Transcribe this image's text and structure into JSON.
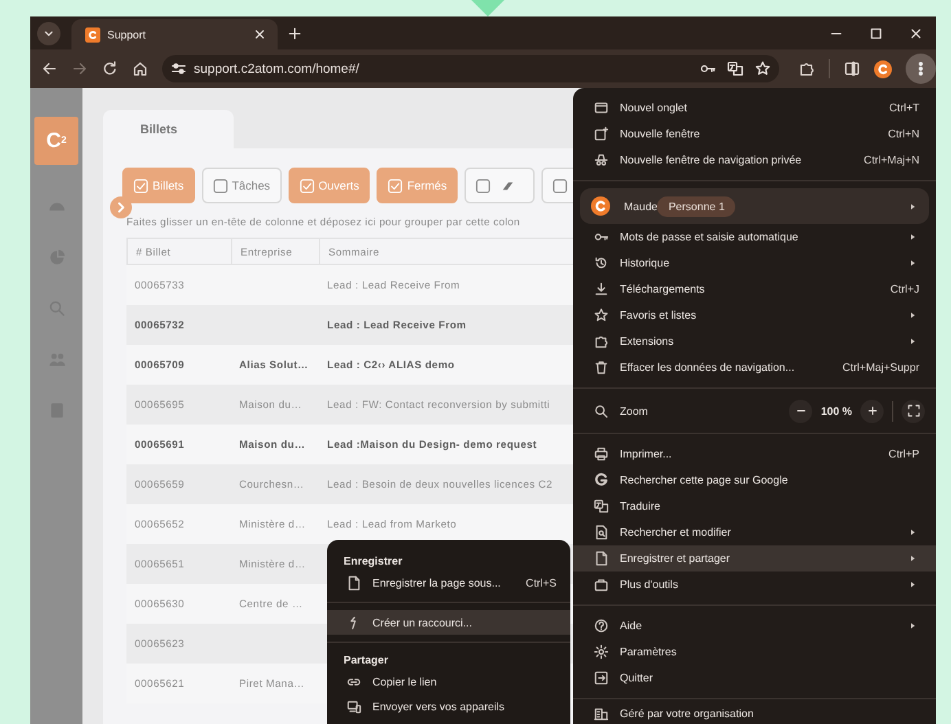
{
  "tabs": [
    {
      "title": "Support",
      "selected": true
    }
  ],
  "toolbar": {
    "url": "support.c2atom.com/home#/"
  },
  "app": {
    "logo": "C$^{2}$",
    "page_tabs": [
      {
        "label": "Billets",
        "selected": true
      }
    ],
    "filters": [
      {
        "kind": "text",
        "label": "Billets",
        "checked": true
      },
      {
        "kind": "text",
        "label": "Tâches",
        "checked": false
      },
      {
        "kind": "text",
        "label": "Ouverts",
        "checked": true
      },
      {
        "kind": "text",
        "label": "Fermés",
        "checked": true
      },
      {
        "kind": "icon",
        "checked": false
      },
      {
        "kind": "icon",
        "checked": false
      }
    ],
    "group_hint": "Faites glisser un en-tête de colonne et déposez ici pour grouper par cette colon",
    "table": {
      "columns": [
        "# Billet",
        "Entreprise",
        "Sommaire"
      ],
      "rows": [
        {
          "cells": [
            "00065733",
            "",
            "Lead : Lead Receive From"
          ],
          "unread": false
        },
        {
          "cells": [
            "00065732",
            "",
            "Lead : Lead Receive From"
          ],
          "unread": true
        },
        {
          "cells": [
            "00065709",
            "Alias Solut…",
            "Lead : C2‹› ALIAS demo"
          ],
          "unread": true
        },
        {
          "cells": [
            "00065695",
            "Maison du…",
            "Lead : FW: Contact reconversion by submitti"
          ],
          "unread": false
        },
        {
          "cells": [
            "00065691",
            "Maison du…",
            "Lead :Maison du Design- demo request"
          ],
          "unread": true
        },
        {
          "cells": [
            "00065659",
            "Courchesn…",
            "Lead : Besoin de deux nouvelles licences C2"
          ],
          "unread": false
        },
        {
          "cells": [
            "00065652",
            "Ministère d…",
            "Lead : Lead from Marketo"
          ],
          "unread": false
        },
        {
          "cells": [
            "00065651",
            "Ministère d…",
            ""
          ],
          "unread": false
        },
        {
          "cells": [
            "00065630",
            "Centre de …",
            ""
          ],
          "unread": false
        },
        {
          "cells": [
            "00065623",
            "",
            ""
          ],
          "unread": false
        },
        {
          "cells": [
            "00065621",
            "Piret Mana…",
            ""
          ],
          "unread": false
        }
      ]
    }
  },
  "menu": {
    "sections": [
      {
        "items": [
          {
            "kind": "item",
            "label": "Nouvel onglet",
            "shortcut": "Ctrl+T",
            "submenu": false,
            "highlighted": false
          },
          {
            "kind": "item",
            "label": "Nouvelle fenêtre",
            "shortcut": "Ctrl+N",
            "submenu": false,
            "highlighted": false
          },
          {
            "kind": "item",
            "label": "Nouvelle fenêtre de navigation privée",
            "shortcut": "Ctrl+Maj+N",
            "submenu": false,
            "highlighted": false
          }
        ]
      },
      {
        "items": [
          {
            "kind": "profile",
            "label": "Maude",
            "badge": "Personne 1",
            "submenu": true,
            "highlighted": false
          },
          {
            "kind": "item",
            "label": "Mots de passe et saisie automatique",
            "submenu": true,
            "highlighted": false
          },
          {
            "kind": "item",
            "label": "Historique",
            "submenu": true,
            "highlighted": false
          },
          {
            "kind": "item",
            "label": "Téléchargements",
            "shortcut": "Ctrl+J",
            "submenu": false,
            "highlighted": false
          },
          {
            "kind": "item",
            "label": "Favoris et listes",
            "submenu": true,
            "highlighted": false
          },
          {
            "kind": "item",
            "label": "Extensions",
            "submenu": true,
            "highlighted": false
          },
          {
            "kind": "item",
            "label": "Effacer les données de navigation...",
            "shortcut": "Ctrl+Maj+Suppr",
            "submenu": false,
            "highlighted": false
          }
        ]
      },
      {
        "items": [
          {
            "kind": "zoom",
            "label": "Zoom",
            "value": "100 %",
            "submenu": false,
            "highlighted": false
          }
        ]
      },
      {
        "items": [
          {
            "kind": "item",
            "label": "Imprimer...",
            "shortcut": "Ctrl+P",
            "submenu": false,
            "highlighted": false
          },
          {
            "kind": "item",
            "label": "Rechercher cette page sur Google",
            "submenu": false,
            "highlighted": false
          },
          {
            "kind": "item",
            "label": "Traduire",
            "submenu": false,
            "highlighted": false
          },
          {
            "kind": "item",
            "label": "Rechercher et modifier",
            "submenu": true,
            "highlighted": false
          },
          {
            "kind": "item",
            "label": "Enregistrer et partager",
            "submenu": true,
            "highlighted": true
          },
          {
            "kind": "item",
            "label": "Plus d'outils",
            "submenu": true,
            "highlighted": false
          }
        ]
      },
      {
        "items": [
          {
            "kind": "item",
            "label": "Aide",
            "submenu": true,
            "highlighted": false
          },
          {
            "kind": "item",
            "label": "Paramètres",
            "submenu": false,
            "highlighted": false
          },
          {
            "kind": "item",
            "label": "Quitter",
            "submenu": false,
            "highlighted": false
          }
        ]
      },
      {
        "items": [
          {
            "kind": "footer",
            "label": "Géré par votre organisation",
            "submenu": false,
            "highlighted": false
          }
        ]
      }
    ]
  },
  "submenu": {
    "groups": [
      {
        "heading": "Enregistrer",
        "items": [
          {
            "label": "Enregistrer la page sous...",
            "shortcut": "Ctrl+S",
            "highlighted": false
          }
        ]
      },
      {
        "items": [
          {
            "label": "Créer un raccourci...",
            "highlighted": true
          }
        ]
      },
      {
        "heading": "Partager",
        "items": [
          {
            "label": "Copier le lien",
            "highlighted": false
          },
          {
            "label": "Envoyer vers vos appareils",
            "highlighted": false
          }
        ]
      }
    ]
  }
}
